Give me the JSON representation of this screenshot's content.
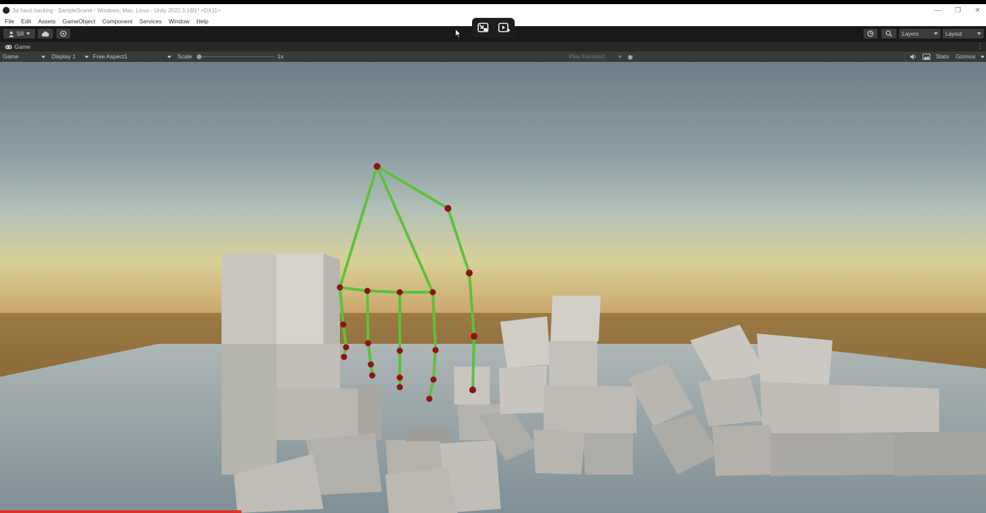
{
  "window": {
    "title": "3d hand tracking - SampleScene - Windows, Mac, Linux - Unity 2022.3.16f1* <DX11>",
    "controls": [
      "—",
      "❐",
      "✕"
    ]
  },
  "menu": [
    "File",
    "Edit",
    "Assets",
    "GameObject",
    "Component",
    "Services",
    "Window",
    "Help"
  ],
  "toolbar": {
    "account_label": "SR",
    "layers_label": "Layers",
    "layout_label": "Layout"
  },
  "tab": {
    "label": "Game"
  },
  "game_toolbar": {
    "mode": "Game",
    "display": "Display 1",
    "aspect": "Free Aspect1",
    "scale_label": "Scale",
    "scale_value": "1x",
    "play_mode": "Play Focused",
    "stats_label": "Stats",
    "gizmos_label": "Gizmos"
  },
  "colors": {
    "bone": "#5cc23a",
    "joint": "#8e1414",
    "sky_top": "#6f7f88",
    "horizon": "#d6c98a",
    "ground": "#8a6a3a",
    "floor": "#9aa6ac",
    "cube": "#c9c7c0",
    "progress": "#dd3322"
  },
  "video_progress": 0.245
}
